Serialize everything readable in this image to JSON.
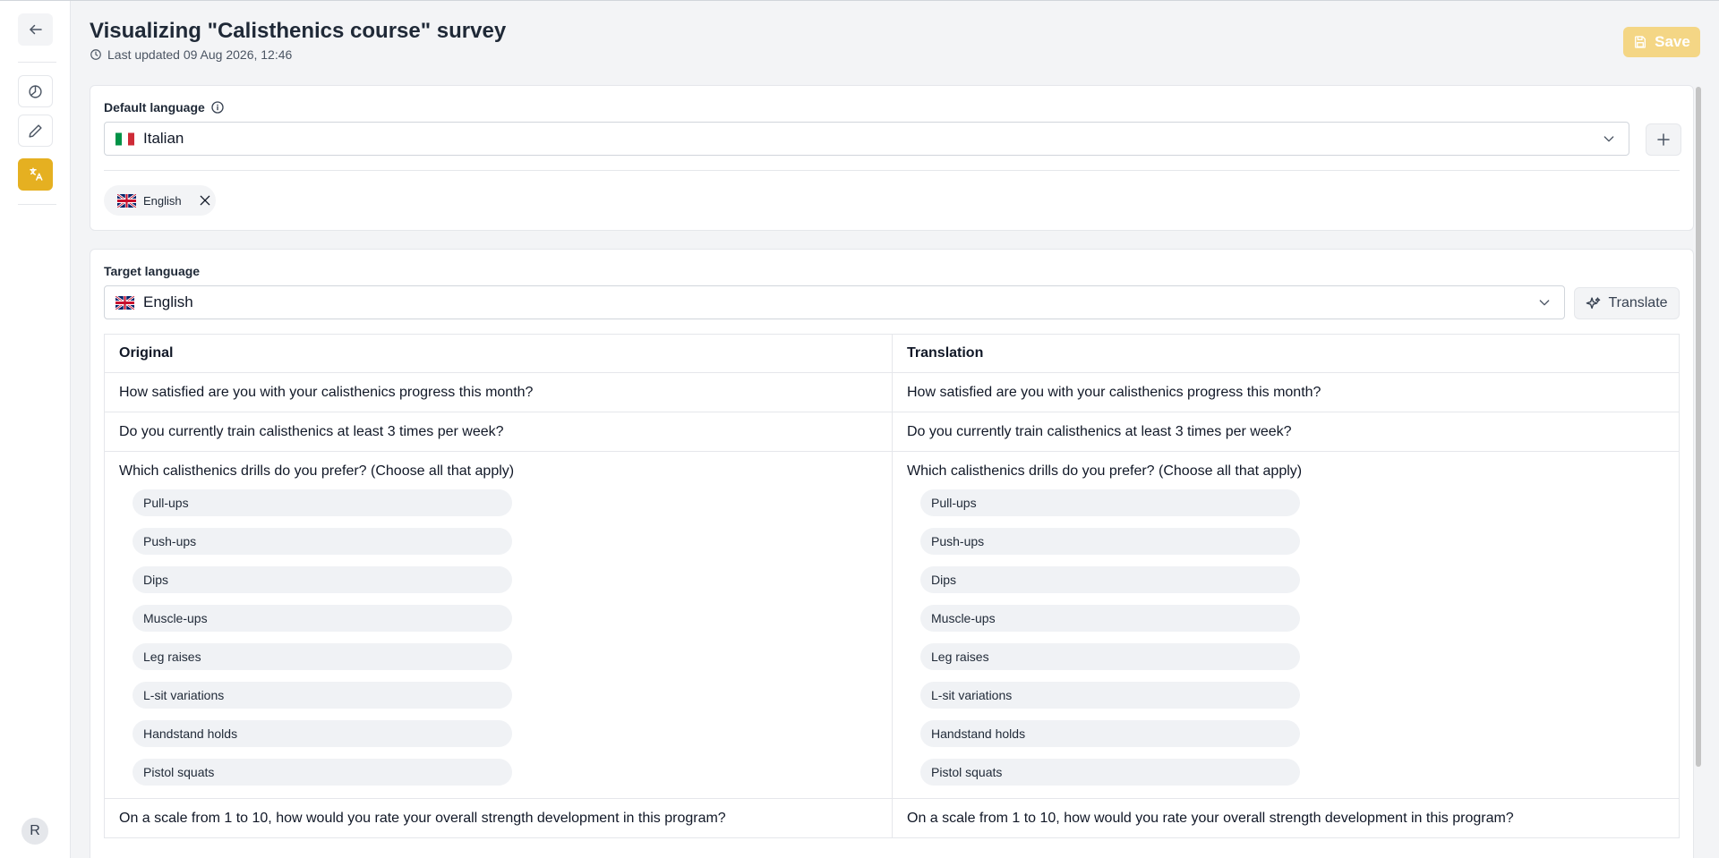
{
  "page": {
    "title": "Visualizing \"Calisthenics course\" survey",
    "last_updated": "Last updated 09 Aug 2026, 12:46",
    "save_label": "Save"
  },
  "sidebar": {
    "icons": [
      "arrow-left-icon",
      "pie-chart-icon",
      "pencil-icon",
      "translate-icon"
    ],
    "avatar": "R"
  },
  "default_language": {
    "label": "Default language",
    "selected": "Italian",
    "added_languages": [
      "English"
    ]
  },
  "target_language": {
    "label": "Target language",
    "selected": "English",
    "translate_label": "Translate"
  },
  "table": {
    "headers": [
      "Original",
      "Translation"
    ],
    "rows": [
      {
        "original": "How satisfied are you with your calisthenics progress this month?",
        "translation": "How satisfied are you with your calisthenics progress this month?"
      },
      {
        "original": "Do you currently train calisthenics at least 3 times per week?",
        "translation": "Do you currently train calisthenics at least 3 times per week?"
      },
      {
        "original": "Which calisthenics drills do you prefer? (Choose all that apply)",
        "translation": "Which calisthenics drills do you prefer? (Choose all that apply)",
        "original_options": [
          "Pull-ups",
          "Push-ups",
          "Dips",
          "Muscle-ups",
          "Leg raises",
          "L-sit variations",
          "Handstand holds",
          "Pistol squats"
        ],
        "translation_options": [
          "Pull-ups",
          "Push-ups",
          "Dips",
          "Muscle-ups",
          "Leg raises",
          "L-sit variations",
          "Handstand holds",
          "Pistol squats"
        ]
      },
      {
        "original": "On a scale from 1 to 10, how would you rate your overall strength development in this program?",
        "translation": "On a scale from 1 to 10, how would you rate your overall strength development in this program?"
      }
    ]
  },
  "colors": {
    "accent": "#e5b021",
    "save_disabled": "#f4d685"
  }
}
